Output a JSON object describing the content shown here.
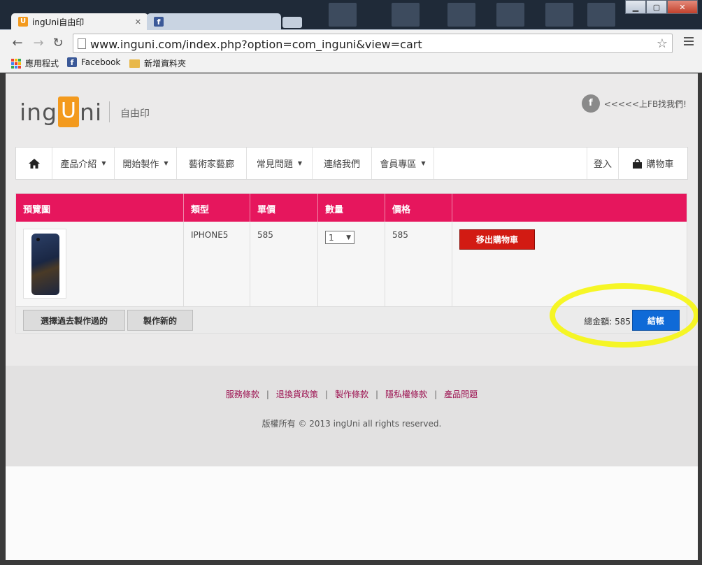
{
  "browser": {
    "tabs": [
      {
        "title": "ingUni自由印",
        "active": true,
        "icon": "ingUni-favicon"
      },
      {
        "title": "",
        "active": false,
        "icon": "facebook-favicon"
      }
    ],
    "url": "www.inguni.com/index.php?option=com_inguni&view=cart",
    "bookmarks": [
      {
        "label": "應用程式",
        "icon": "apps-grid-icon"
      },
      {
        "label": "Facebook",
        "icon": "facebook-icon"
      },
      {
        "label": "新增資料夾",
        "icon": "folder-icon"
      }
    ]
  },
  "header": {
    "logo_left": "ing",
    "logo_u": "U",
    "logo_right": "ni",
    "logo_sub": "自由印",
    "fb_link": "<<<<<上FB找我們!",
    "fb_icon": "f"
  },
  "nav": {
    "items": [
      {
        "label": "產品介紹",
        "dropdown": true
      },
      {
        "label": "開始製作",
        "dropdown": true
      },
      {
        "label": "藝術家藝廊",
        "dropdown": false
      },
      {
        "label": "常見問題",
        "dropdown": true
      },
      {
        "label": "連絡我們",
        "dropdown": false
      },
      {
        "label": "會員專區",
        "dropdown": true
      }
    ],
    "login": "登入",
    "cart": "購物車"
  },
  "cart": {
    "headers": [
      "預覽圖",
      "類型",
      "單價",
      "數量",
      "價格",
      ""
    ],
    "rows": [
      {
        "type": "IPHONE5",
        "unit_price": "585",
        "quantity": "1",
        "price": "585",
        "remove_label": "移出購物車"
      }
    ],
    "select_past_label": "選擇過去製作過的",
    "make_new_label": "製作新的",
    "total_label": "總金額: 585",
    "checkout_label": "結帳"
  },
  "footer": {
    "links": [
      "服務條款",
      "退換貨政策",
      "製作條款",
      "隱私權條款",
      "產品問題"
    ],
    "copyright": "版權所有 © 2013  ingUni  all rights reserved."
  },
  "colors": {
    "brand_orange": "#f39a1e",
    "table_header": "#e6165d",
    "remove_button": "#d21b13",
    "checkout_button": "#0f6ad7",
    "footer_link": "#9c1150",
    "highlight": "#f5f51a"
  }
}
